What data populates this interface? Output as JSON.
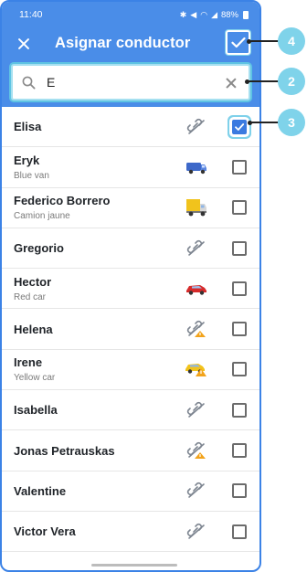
{
  "status": {
    "time": "11:40",
    "battery": "88%"
  },
  "appbar": {
    "title": "Asignar conductor"
  },
  "search": {
    "value": "E"
  },
  "drivers": [
    {
      "name": "Elisa",
      "subtitle": "",
      "icon": "link-off-icon",
      "checked": true
    },
    {
      "name": "Eryk",
      "subtitle": "Blue van",
      "icon": "blue-van-icon",
      "checked": false
    },
    {
      "name": "Federico Borrero",
      "subtitle": "Camion jaune",
      "icon": "yellow-truck-icon",
      "checked": false
    },
    {
      "name": "Gregorio",
      "subtitle": "",
      "icon": "link-off-icon",
      "checked": false
    },
    {
      "name": "Hector",
      "subtitle": "Red car",
      "icon": "red-car-icon",
      "checked": false
    },
    {
      "name": "Helena",
      "subtitle": "",
      "icon": "link-off-warning-icon",
      "checked": false
    },
    {
      "name": "Irene",
      "subtitle": "Yellow car",
      "icon": "yellow-car-warning-icon",
      "checked": false
    },
    {
      "name": "Isabella",
      "subtitle": "",
      "icon": "link-off-icon",
      "checked": false
    },
    {
      "name": "Jonas Petrauskas",
      "subtitle": "",
      "icon": "link-off-warning-icon",
      "checked": false
    },
    {
      "name": "Valentine",
      "subtitle": "",
      "icon": "link-off-icon",
      "checked": false
    },
    {
      "name": "Victor Vera",
      "subtitle": "",
      "icon": "link-off-icon",
      "checked": false
    }
  ],
  "callouts": [
    "4",
    "2",
    "3"
  ],
  "colors": {
    "accent": "#4a8de8",
    "callout": "#7fd3ea",
    "checkbox": "#3b7ae0"
  }
}
